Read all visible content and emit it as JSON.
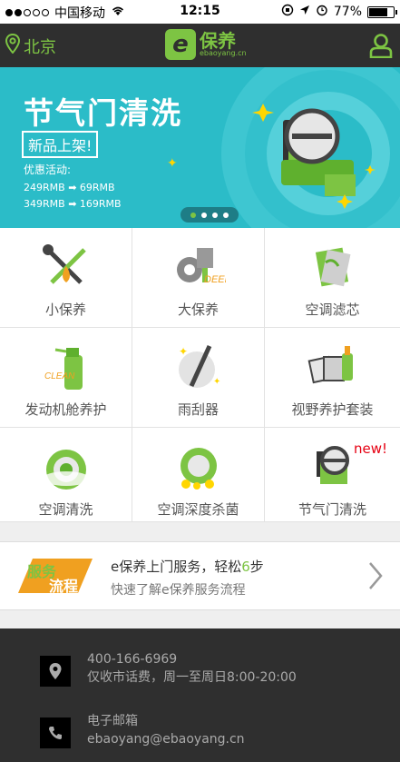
{
  "status_bar": {
    "carrier": "中国移动",
    "time": "12:15",
    "battery": "77%",
    "battery_level": 0.77
  },
  "nav": {
    "city": "北京",
    "logo_main": "保养",
    "logo_mark": "e",
    "logo_sub": "ebaoyang.cn"
  },
  "banner": {
    "title": "节气门清洗",
    "tag": "新品上架!",
    "promo_label": "优惠活动:",
    "price_1_from": "249RMB",
    "price_1_to": "69RMB",
    "price_2_from": "349RMB",
    "price_2_to": "169RMB",
    "slide_count": 4,
    "active_slide": 0
  },
  "services": [
    {
      "label": "小保养",
      "icon": "wrench-icon"
    },
    {
      "label": "大保养",
      "icon": "gear-piston-icon",
      "icon_text": "DEEP"
    },
    {
      "label": "空调滤芯",
      "icon": "filter-icon"
    },
    {
      "label": "发动机舱养护",
      "icon": "spray-bottle-icon",
      "icon_text": "CLEAN"
    },
    {
      "label": "雨刮器",
      "icon": "wiper-icon"
    },
    {
      "label": "视野养护套装",
      "icon": "glass-care-kit-icon"
    },
    {
      "label": "空调清洗",
      "icon": "ac-clean-icon"
    },
    {
      "label": "空调深度杀菌",
      "icon": "ac-sterilize-icon"
    },
    {
      "label": "节气门清洗",
      "icon": "throttle-icon",
      "badge": "new!"
    }
  ],
  "service_flow": {
    "badge_top": "服务",
    "badge_bottom": "流程",
    "title_prefix": "e保养上门服务，轻松",
    "title_num": "6",
    "title_suffix": "步",
    "subtitle": "快速了解e保养服务流程"
  },
  "footer": {
    "phone": "400-166-6969",
    "phone_note": "仅收市话费，周一至周日8:00-20:00",
    "email_label": "电子邮箱",
    "email": "ebaoyang@ebaoyang.cn"
  },
  "colors": {
    "brand_green": "#7dc443",
    "banner_teal": "#2bbcc8",
    "nav_dark": "#2f2f2f",
    "new_red": "#e60012"
  }
}
